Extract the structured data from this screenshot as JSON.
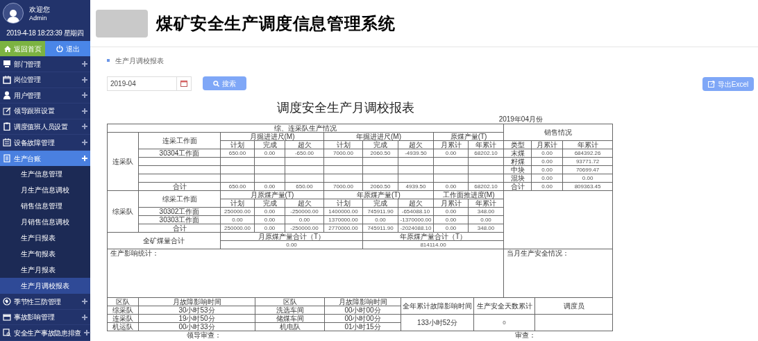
{
  "user": {
    "greeting": "欢迎您",
    "name": "Admin",
    "datetime": "2019-4-18 18:23:39 星期四"
  },
  "top_buttons": [
    {
      "label": "返回首页",
      "kind": "home"
    },
    {
      "label": "退出",
      "kind": "logout"
    }
  ],
  "sidebar": {
    "items": [
      {
        "label": "部门管理",
        "expanded": false
      },
      {
        "label": "岗位管理",
        "expanded": false
      },
      {
        "label": "用户管理",
        "expanded": false
      },
      {
        "label": "领导跟班设置",
        "expanded": false
      },
      {
        "label": "调度值班人员设置",
        "expanded": false
      },
      {
        "label": "设备故障管理",
        "expanded": false
      },
      {
        "label": "生产台账",
        "expanded": true,
        "children": [
          {
            "label": "生产信息管理",
            "selected": false
          },
          {
            "label": "月生产信息调校",
            "selected": false
          },
          {
            "label": "销售信息管理",
            "selected": false
          },
          {
            "label": "月销售信息调校",
            "selected": false
          },
          {
            "label": "生产日报表",
            "selected": false
          },
          {
            "label": "生产旬报表",
            "selected": false
          },
          {
            "label": "生产月报表",
            "selected": false
          },
          {
            "label": "生产月调校报表",
            "selected": true
          }
        ]
      },
      {
        "label": "季节性三防管理",
        "expanded": false
      },
      {
        "label": "事故影响管理",
        "expanded": false
      },
      {
        "label": "安全生产事故隐患排查",
        "expanded": false
      }
    ]
  },
  "header": {
    "title": "煤矿安全生产调度信息管理系统"
  },
  "breadcrumb": "生产月调校报表",
  "filter": {
    "month": "2019-04",
    "search_label": "搜索",
    "export_label": "导出Excel"
  },
  "report": {
    "title": "调度安全生产月调校报表",
    "period": "2019年04月份",
    "section_title": "综、连采队生产情况",
    "continuous": {
      "team": "连采队",
      "face_header": "连采工作面",
      "groups": [
        "月掘进进尺(M)",
        "年掘进进尺(M)",
        "原煤产量(T)"
      ],
      "subheaders": [
        "计划",
        "完成",
        "超欠",
        "计划",
        "完成",
        "超欠",
        "月累计",
        "年累计"
      ],
      "rows": [
        [
          "30304工作面",
          "650.00",
          "0.00",
          "-650.00",
          "7000.00",
          "2060.50",
          "-4939.50",
          "0.00",
          "68202.10"
        ]
      ],
      "total": [
        "合计",
        "650.00",
        "0.00",
        "650.00",
        "7000.00",
        "2060.50",
        "4939.50",
        "0.00",
        "68202.10"
      ]
    },
    "mechanized": {
      "team": "综采队",
      "face_header": "综采工作面",
      "groups": [
        "月原煤产量(T)",
        "年原煤产量(T)",
        "工作面推进度(M)"
      ],
      "subheaders": [
        "计划",
        "完成",
        "超欠",
        "计划",
        "完成",
        "超欠",
        "月累计",
        "年累计"
      ],
      "rows": [
        [
          "30302工作面",
          "250000.00",
          "0.00",
          "-250000.00",
          "1400000.00",
          "745911.90",
          "-654088.10",
          "0.00",
          "348.00"
        ],
        [
          "30303工作面",
          "0.00",
          "0.00",
          "0.00",
          "1370000.00",
          "0.00",
          "-1370000.00",
          "0.00",
          "0.00"
        ]
      ],
      "total": [
        "合计",
        "250000.00",
        "0.00",
        "-250000.00",
        "2770000.00",
        "745911.90",
        "-2024088.10",
        "0.00",
        "348.00"
      ]
    },
    "sales": {
      "title": "销售情况",
      "columns": [
        "类型",
        "月累计",
        "年累计"
      ],
      "rows": [
        [
          "末煤",
          "0.00",
          "684392.26"
        ],
        [
          "籽煤",
          "0.00",
          "93771.72"
        ],
        [
          "中块",
          "0.00",
          "70699.47"
        ],
        [
          "混块",
          "0.00",
          "0.00"
        ],
        [
          "合计",
          "0.00",
          "809363.45"
        ]
      ]
    },
    "mine_total": {
      "label": "全矿煤量合计",
      "month_label": "月原煤产量合计（T）",
      "month_value": "0.00",
      "year_label": "年原煤产量合计（T）",
      "year_value": "814114.00"
    },
    "impact_label": "生产影响统计：",
    "safety_label": "当月生产安全情况：",
    "faults": {
      "columns": [
        "区队",
        "月故障影响时间",
        "区队",
        "月故障影响时间"
      ],
      "summary_headers": [
        "全年累计故障影响时间",
        "生产安全天数累计",
        "调度员"
      ],
      "rows": [
        [
          "综采队",
          "30小时53分",
          "洗选车间",
          "00小时00分"
        ],
        [
          "连采队",
          "19小时50分",
          "储煤车间",
          "00小时00分"
        ],
        [
          "机运队",
          "00小时33分",
          "机电队",
          "01小时15分"
        ]
      ],
      "annual_total": "133小时52分",
      "safe_days": "0"
    },
    "signatures": [
      "领导审查：",
      "审查："
    ]
  }
}
